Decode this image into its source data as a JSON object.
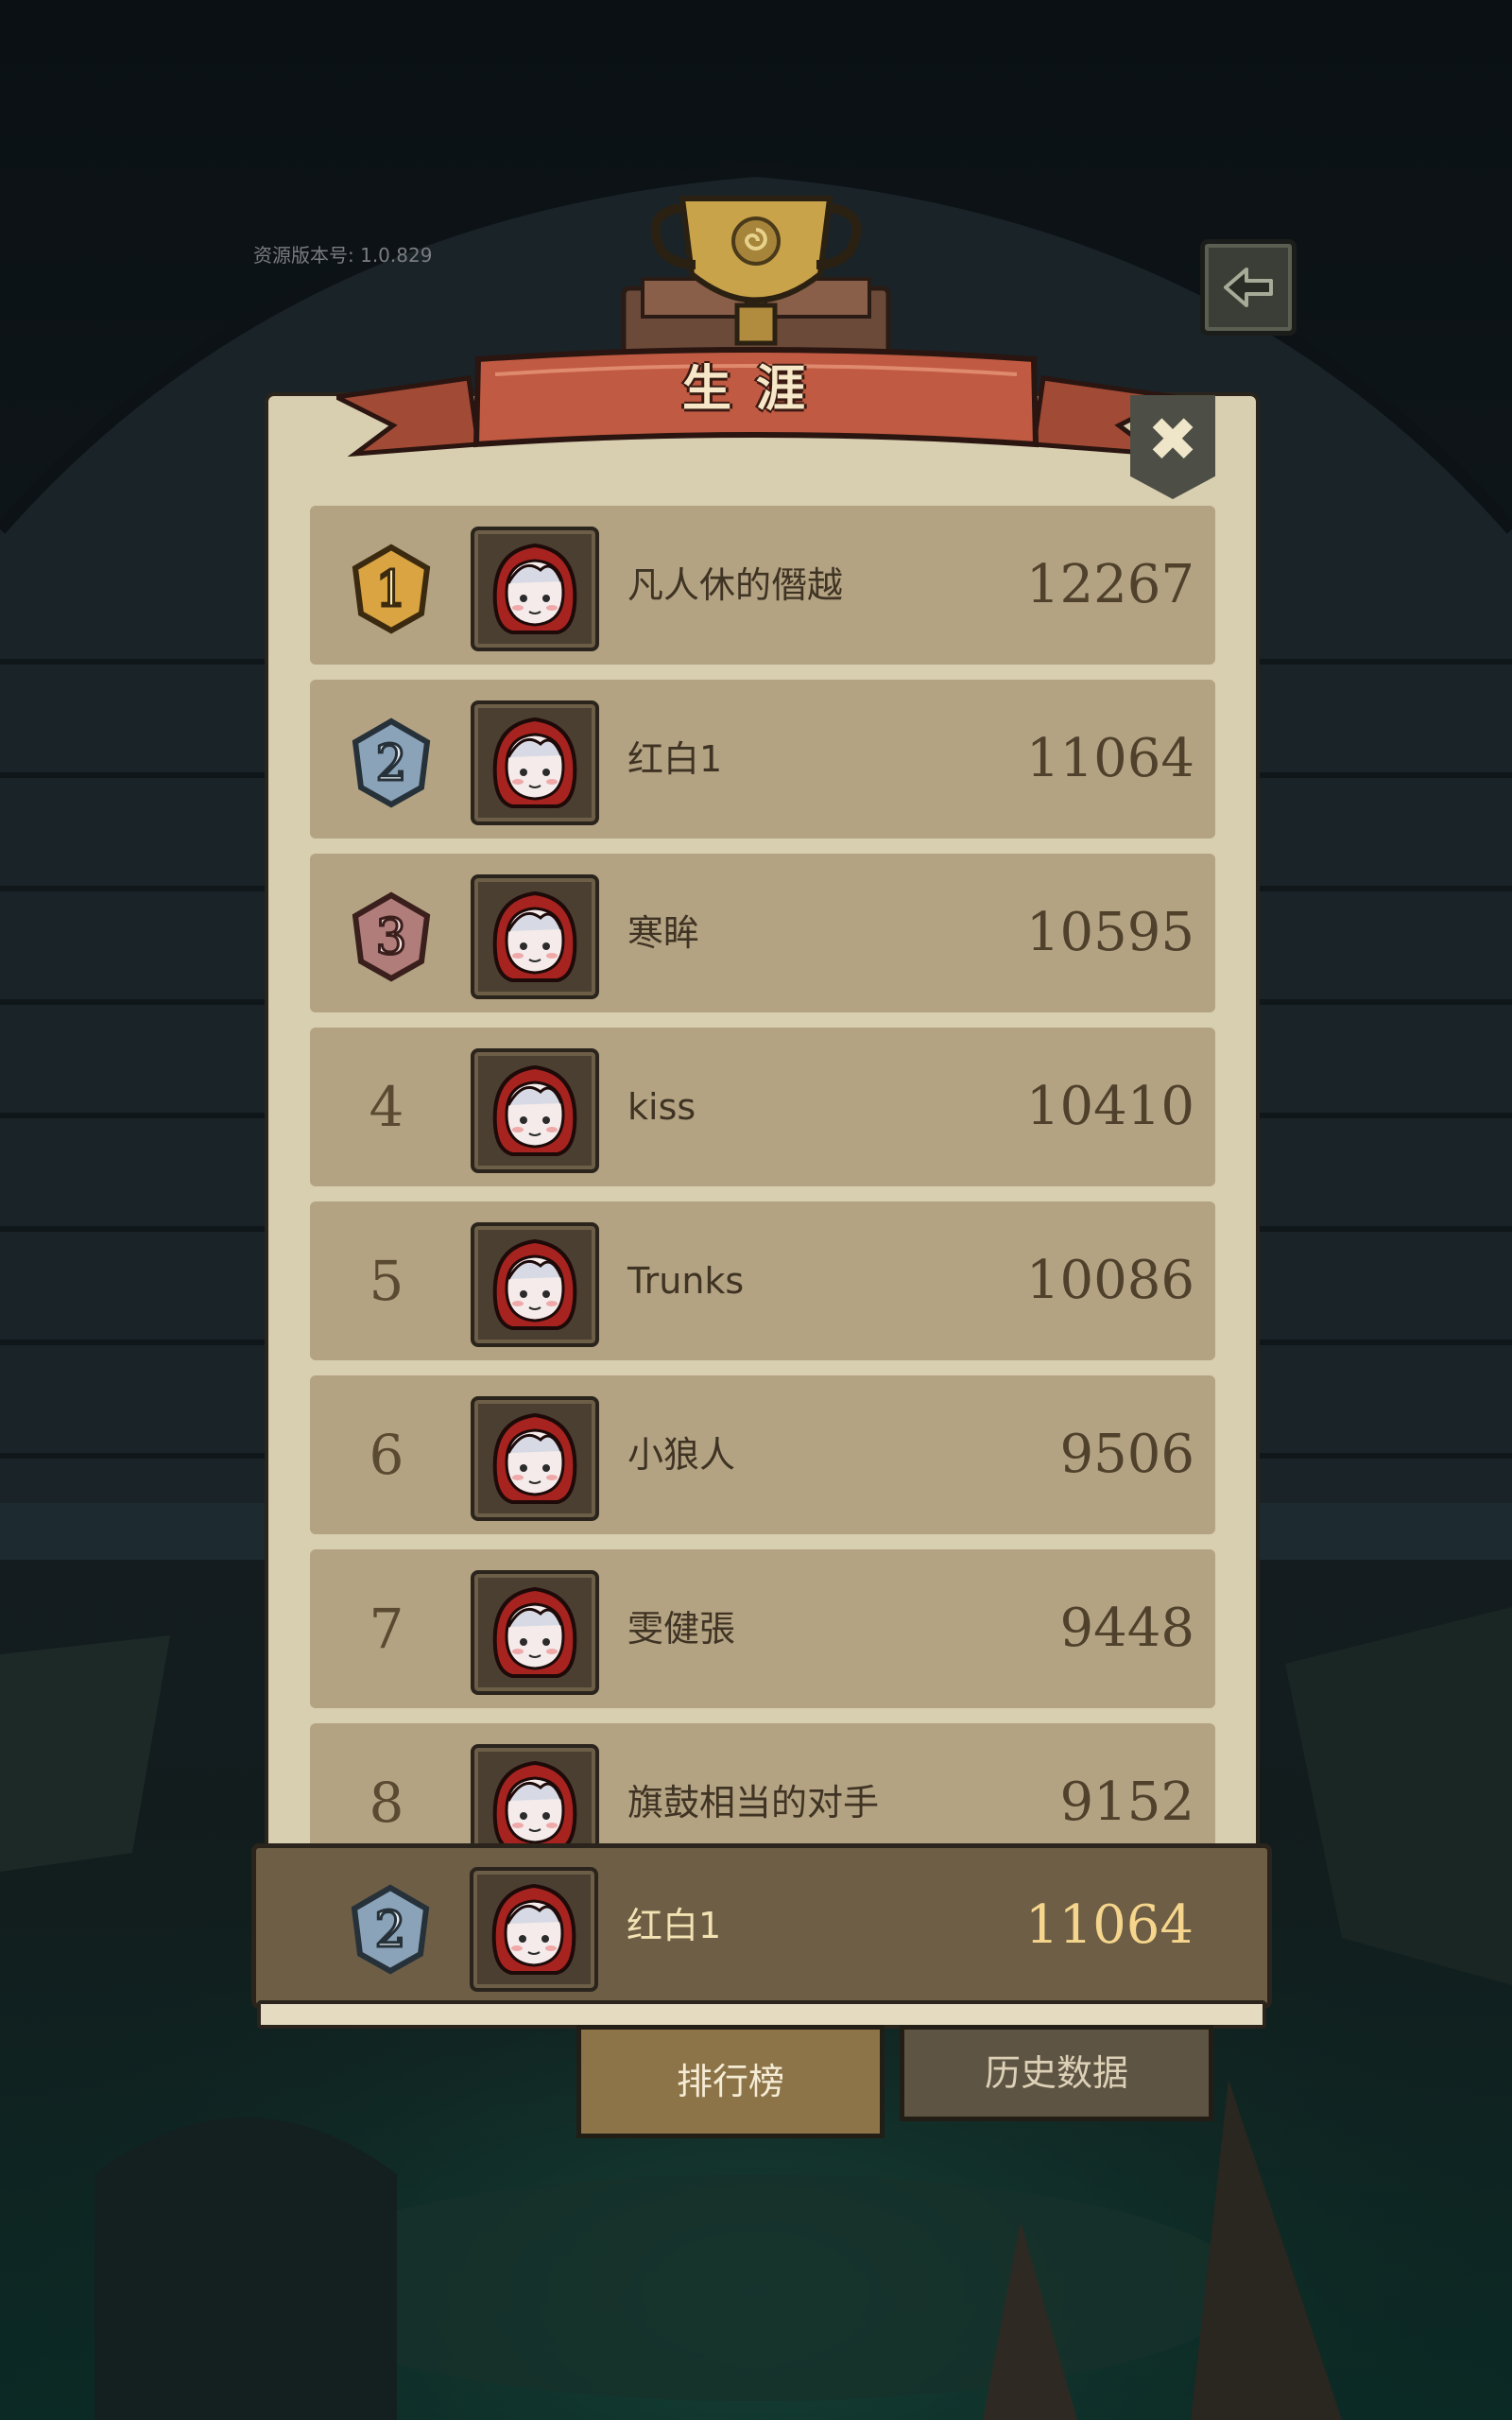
{
  "version_label": "资源版本号: 1.0.829",
  "title": "生涯",
  "colors": {
    "panel": "#d8ceb0",
    "row": "#b3a382",
    "my_bar": "#6d5e45",
    "gold": "#d9a441",
    "silver": "#8aa3b8",
    "bronze": "#b07d7a"
  },
  "icons": {
    "back": "back-arrow-icon",
    "close": "close-x-icon",
    "trophy": "trophy-icon"
  },
  "leaderboard": [
    {
      "rank": "1",
      "medal": "gold",
      "name": "凡人休的僭越",
      "score": "12267"
    },
    {
      "rank": "2",
      "medal": "silver",
      "name": "红白1",
      "score": "11064"
    },
    {
      "rank": "3",
      "medal": "bronze",
      "name": "寒眸",
      "score": "10595"
    },
    {
      "rank": "4",
      "medal": "",
      "name": "kiss",
      "score": "10410"
    },
    {
      "rank": "5",
      "medal": "",
      "name": "Trunks",
      "score": "10086"
    },
    {
      "rank": "6",
      "medal": "",
      "name": "小狼人",
      "score": "9506"
    },
    {
      "rank": "7",
      "medal": "",
      "name": "雯健張",
      "score": "9448"
    },
    {
      "rank": "8",
      "medal": "",
      "name": "旗鼓相当的对手",
      "score": "9152"
    }
  ],
  "my_rank": {
    "rank": "2",
    "medal": "silver",
    "name": "红白1",
    "score": "11064"
  },
  "tabs": {
    "leaderboard": "排行榜",
    "history": "历史数据"
  }
}
